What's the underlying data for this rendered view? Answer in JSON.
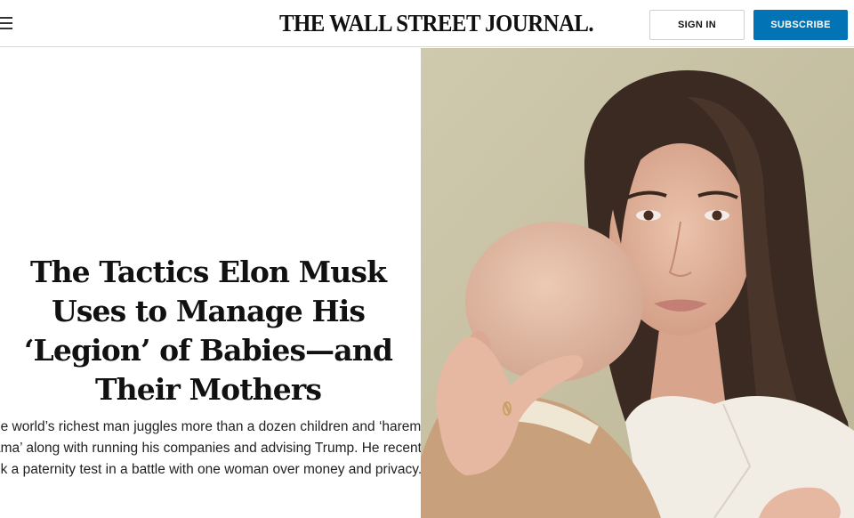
{
  "header": {
    "menu_icon": "hamburger-menu-icon",
    "masthead": "THE WALL STREET JOURNAL.",
    "signin_label": "SIGN IN",
    "subscribe_label": "SUBSCRIBE",
    "colors": {
      "subscribe_bg": "#0274b6",
      "border": "#d9d9d9"
    }
  },
  "article": {
    "headline_lines": [
      "The Tactics Elon Musk",
      "Uses to Manage His",
      "‘Legion’ of Babies—and",
      "Their Mothers"
    ],
    "dek_lines": [
      "he world’s richest man juggles more than a dozen children and ‘harem",
      "ama’ along with running his companies and advising Trump. He recently",
      "ok a paternity test in a battle with one woman over money and privacy."
    ]
  },
  "photo": {
    "subject": "woman-holding-baby-photo"
  }
}
